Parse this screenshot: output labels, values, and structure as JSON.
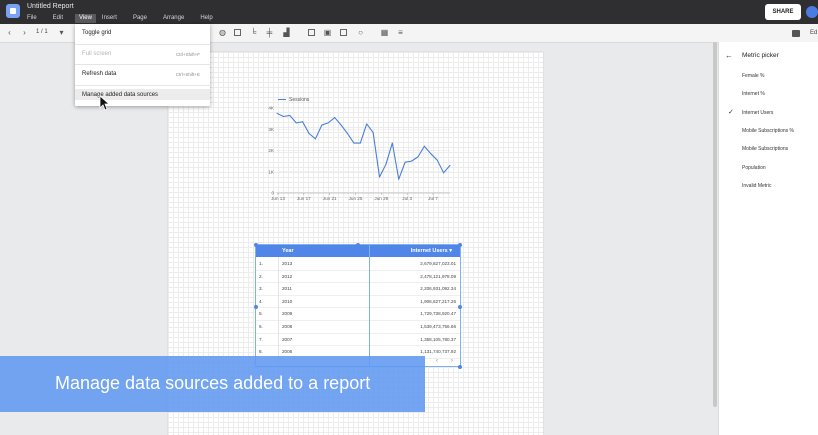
{
  "window": {
    "title": "Untitled Report"
  },
  "menu": [
    "File",
    "Edit",
    "View",
    "Insert",
    "Page",
    "Arrange",
    "Help"
  ],
  "header": {
    "share_label": "SHARE"
  },
  "toolbar": {
    "page_indicator": "1 / 1"
  },
  "view_menu": {
    "items": [
      {
        "label": "Toggle grid",
        "shortcut": "",
        "disabled": false
      },
      {
        "label": "Full screen",
        "shortcut": "Ctrl+Shift+F",
        "disabled": true
      },
      {
        "label": "Refresh data",
        "shortcut": "Ctrl+Shift+E",
        "disabled": false
      },
      {
        "label": "Manage added data sources",
        "shortcut": "",
        "disabled": false
      }
    ]
  },
  "chart_data": {
    "type": "line",
    "title": "",
    "xlabel": "",
    "ylabel": "",
    "legend": [
      "Sessions"
    ],
    "legend_position": "top-left",
    "x_ticks": [
      "Jun 13",
      "Jun 17",
      "Jun 21",
      "Jun 25",
      "Jun 29",
      "Jul 3",
      "Jul 7"
    ],
    "y_ticks": [
      "0",
      "1K",
      "2K",
      "3K",
      "4K"
    ],
    "ylim": [
      0,
      4000
    ],
    "series": [
      {
        "name": "Sessions",
        "values": [
          3750,
          3600,
          3650,
          3300,
          3350,
          2800,
          2550,
          3200,
          3300,
          3550,
          3200,
          2800,
          2350,
          2350,
          3250,
          2850,
          750,
          1350,
          2350,
          650,
          1450,
          1500,
          1700,
          2200,
          1850,
          1550,
          950,
          1300
        ]
      }
    ]
  },
  "table": {
    "columns": [
      "Year",
      "Internet Users"
    ],
    "sort_indicator": "▾",
    "rows": [
      {
        "n": "1.",
        "year": "2013",
        "value": "2,679,827,023.01"
      },
      {
        "n": "2.",
        "year": "2012",
        "value": "2,478,121,978.09"
      },
      {
        "n": "3.",
        "year": "2011",
        "value": "2,206,931,092.34"
      },
      {
        "n": "4.",
        "year": "2010",
        "value": "1,906,627,217.26"
      },
      {
        "n": "5.",
        "year": "2009",
        "value": "1,729,738,920.47"
      },
      {
        "n": "6.",
        "year": "2008",
        "value": "1,539,473,756.66"
      },
      {
        "n": "7.",
        "year": "2007",
        "value": "1,358,105,780.37"
      },
      {
        "n": "8.",
        "year": "2006",
        "value": "1,131,740,737.92"
      }
    ]
  },
  "metric_picker": {
    "title": "Metric picker",
    "items": [
      {
        "label": "Female %",
        "checked": false
      },
      {
        "label": "Internet %",
        "checked": false
      },
      {
        "label": "Internet Users",
        "checked": true
      },
      {
        "label": "Mobile Subscriptions %",
        "checked": false
      },
      {
        "label": "Mobile Subscriptions",
        "checked": false
      },
      {
        "label": "Population",
        "checked": false
      },
      {
        "label": "Invalid Metric",
        "checked": false
      }
    ],
    "edit_label": "Ed"
  },
  "caption": "Manage data sources added to a report",
  "colors": {
    "accent": "#4f86e8",
    "series": "#4a7fd8",
    "caption_bg": "#6099f0",
    "topbar": "#2f2f31"
  }
}
